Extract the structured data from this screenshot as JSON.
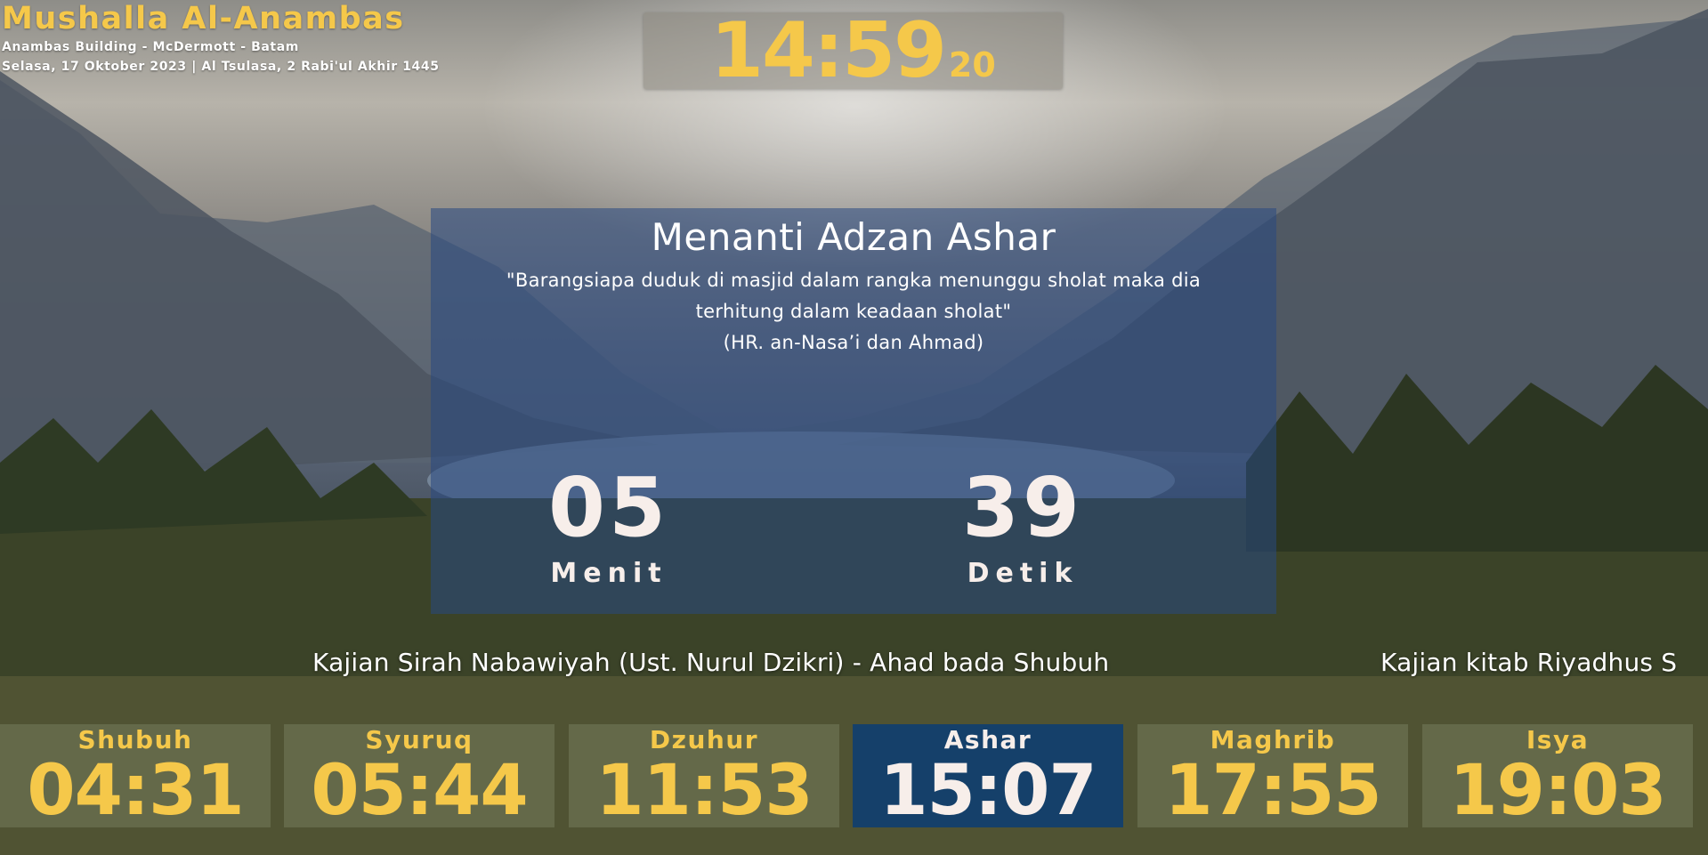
{
  "header": {
    "mosque_name": "Mushalla Al-Anambas",
    "location": "Anambas Building - McDermott - Batam",
    "date_line": "Selasa, 17 Oktober 2023 | Al Tsulasa, 2 Rabi'ul Akhir 1445"
  },
  "clock": {
    "time": "14:59",
    "seconds": "20"
  },
  "countdown": {
    "title": "Menanti Adzan Ashar",
    "hadith_line1": "\"Barangsiapa duduk di masjid dalam rangka menunggu sholat maka dia",
    "hadith_line2": "terhitung dalam keadaan sholat\"",
    "hadith_source": "(HR. an-Nasa’i dan Ahmad)",
    "minutes": "05",
    "minutes_label": "Menit",
    "seconds": "39",
    "seconds_label": "Detik"
  },
  "ticker": [
    "Kajian Sirah Nabawiyah (Ust. Nurul Dzikri) - Ahad bada Shubuh",
    "Kajian kitab Riyadhus S"
  ],
  "prayers": [
    {
      "name": "Shubuh",
      "time": "04:31"
    },
    {
      "name": "Syuruq",
      "time": "05:44"
    },
    {
      "name": "Dzuhur",
      "time": "11:53"
    },
    {
      "name": "Ashar",
      "time": "15:07",
      "active": true
    },
    {
      "name": "Maghrib",
      "time": "17:55"
    },
    {
      "name": "Isya",
      "time": "19:03"
    }
  ],
  "colors": {
    "accent": "#f5c84a",
    "active_card": "#15406a",
    "countdown_panel": "#284882"
  }
}
